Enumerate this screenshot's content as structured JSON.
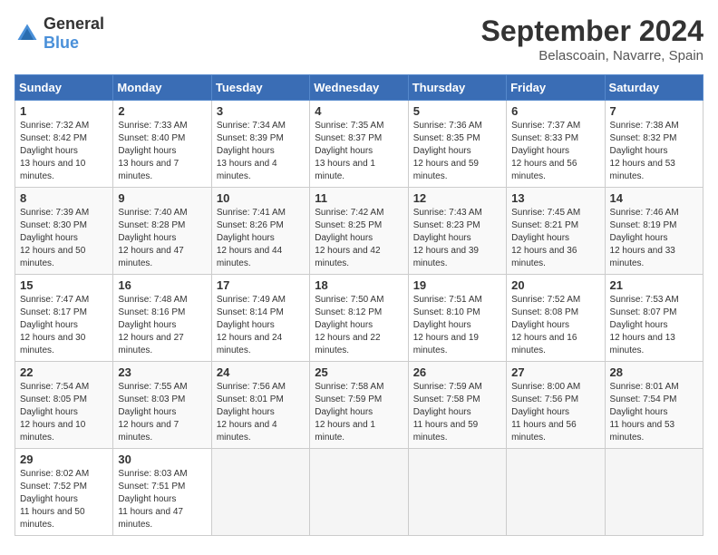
{
  "logo": {
    "general": "General",
    "blue": "Blue"
  },
  "title": "September 2024",
  "location": "Belascoain, Navarre, Spain",
  "days_of_week": [
    "Sunday",
    "Monday",
    "Tuesday",
    "Wednesday",
    "Thursday",
    "Friday",
    "Saturday"
  ],
  "weeks": [
    [
      {
        "day": 1,
        "sunrise": "7:32 AM",
        "sunset": "8:42 PM",
        "daylight": "13 hours and 10 minutes."
      },
      {
        "day": 2,
        "sunrise": "7:33 AM",
        "sunset": "8:40 PM",
        "daylight": "13 hours and 7 minutes."
      },
      {
        "day": 3,
        "sunrise": "7:34 AM",
        "sunset": "8:39 PM",
        "daylight": "13 hours and 4 minutes."
      },
      {
        "day": 4,
        "sunrise": "7:35 AM",
        "sunset": "8:37 PM",
        "daylight": "13 hours and 1 minute."
      },
      {
        "day": 5,
        "sunrise": "7:36 AM",
        "sunset": "8:35 PM",
        "daylight": "12 hours and 59 minutes."
      },
      {
        "day": 6,
        "sunrise": "7:37 AM",
        "sunset": "8:33 PM",
        "daylight": "12 hours and 56 minutes."
      },
      {
        "day": 7,
        "sunrise": "7:38 AM",
        "sunset": "8:32 PM",
        "daylight": "12 hours and 53 minutes."
      }
    ],
    [
      {
        "day": 8,
        "sunrise": "7:39 AM",
        "sunset": "8:30 PM",
        "daylight": "12 hours and 50 minutes."
      },
      {
        "day": 9,
        "sunrise": "7:40 AM",
        "sunset": "8:28 PM",
        "daylight": "12 hours and 47 minutes."
      },
      {
        "day": 10,
        "sunrise": "7:41 AM",
        "sunset": "8:26 PM",
        "daylight": "12 hours and 44 minutes."
      },
      {
        "day": 11,
        "sunrise": "7:42 AM",
        "sunset": "8:25 PM",
        "daylight": "12 hours and 42 minutes."
      },
      {
        "day": 12,
        "sunrise": "7:43 AM",
        "sunset": "8:23 PM",
        "daylight": "12 hours and 39 minutes."
      },
      {
        "day": 13,
        "sunrise": "7:45 AM",
        "sunset": "8:21 PM",
        "daylight": "12 hours and 36 minutes."
      },
      {
        "day": 14,
        "sunrise": "7:46 AM",
        "sunset": "8:19 PM",
        "daylight": "12 hours and 33 minutes."
      }
    ],
    [
      {
        "day": 15,
        "sunrise": "7:47 AM",
        "sunset": "8:17 PM",
        "daylight": "12 hours and 30 minutes."
      },
      {
        "day": 16,
        "sunrise": "7:48 AM",
        "sunset": "8:16 PM",
        "daylight": "12 hours and 27 minutes."
      },
      {
        "day": 17,
        "sunrise": "7:49 AM",
        "sunset": "8:14 PM",
        "daylight": "12 hours and 24 minutes."
      },
      {
        "day": 18,
        "sunrise": "7:50 AM",
        "sunset": "8:12 PM",
        "daylight": "12 hours and 22 minutes."
      },
      {
        "day": 19,
        "sunrise": "7:51 AM",
        "sunset": "8:10 PM",
        "daylight": "12 hours and 19 minutes."
      },
      {
        "day": 20,
        "sunrise": "7:52 AM",
        "sunset": "8:08 PM",
        "daylight": "12 hours and 16 minutes."
      },
      {
        "day": 21,
        "sunrise": "7:53 AM",
        "sunset": "8:07 PM",
        "daylight": "12 hours and 13 minutes."
      }
    ],
    [
      {
        "day": 22,
        "sunrise": "7:54 AM",
        "sunset": "8:05 PM",
        "daylight": "12 hours and 10 minutes."
      },
      {
        "day": 23,
        "sunrise": "7:55 AM",
        "sunset": "8:03 PM",
        "daylight": "12 hours and 7 minutes."
      },
      {
        "day": 24,
        "sunrise": "7:56 AM",
        "sunset": "8:01 PM",
        "daylight": "12 hours and 4 minutes."
      },
      {
        "day": 25,
        "sunrise": "7:58 AM",
        "sunset": "7:59 PM",
        "daylight": "12 hours and 1 minute."
      },
      {
        "day": 26,
        "sunrise": "7:59 AM",
        "sunset": "7:58 PM",
        "daylight": "11 hours and 59 minutes."
      },
      {
        "day": 27,
        "sunrise": "8:00 AM",
        "sunset": "7:56 PM",
        "daylight": "11 hours and 56 minutes."
      },
      {
        "day": 28,
        "sunrise": "8:01 AM",
        "sunset": "7:54 PM",
        "daylight": "11 hours and 53 minutes."
      }
    ],
    [
      {
        "day": 29,
        "sunrise": "8:02 AM",
        "sunset": "7:52 PM",
        "daylight": "11 hours and 50 minutes."
      },
      {
        "day": 30,
        "sunrise": "8:03 AM",
        "sunset": "7:51 PM",
        "daylight": "11 hours and 47 minutes."
      },
      null,
      null,
      null,
      null,
      null
    ]
  ]
}
